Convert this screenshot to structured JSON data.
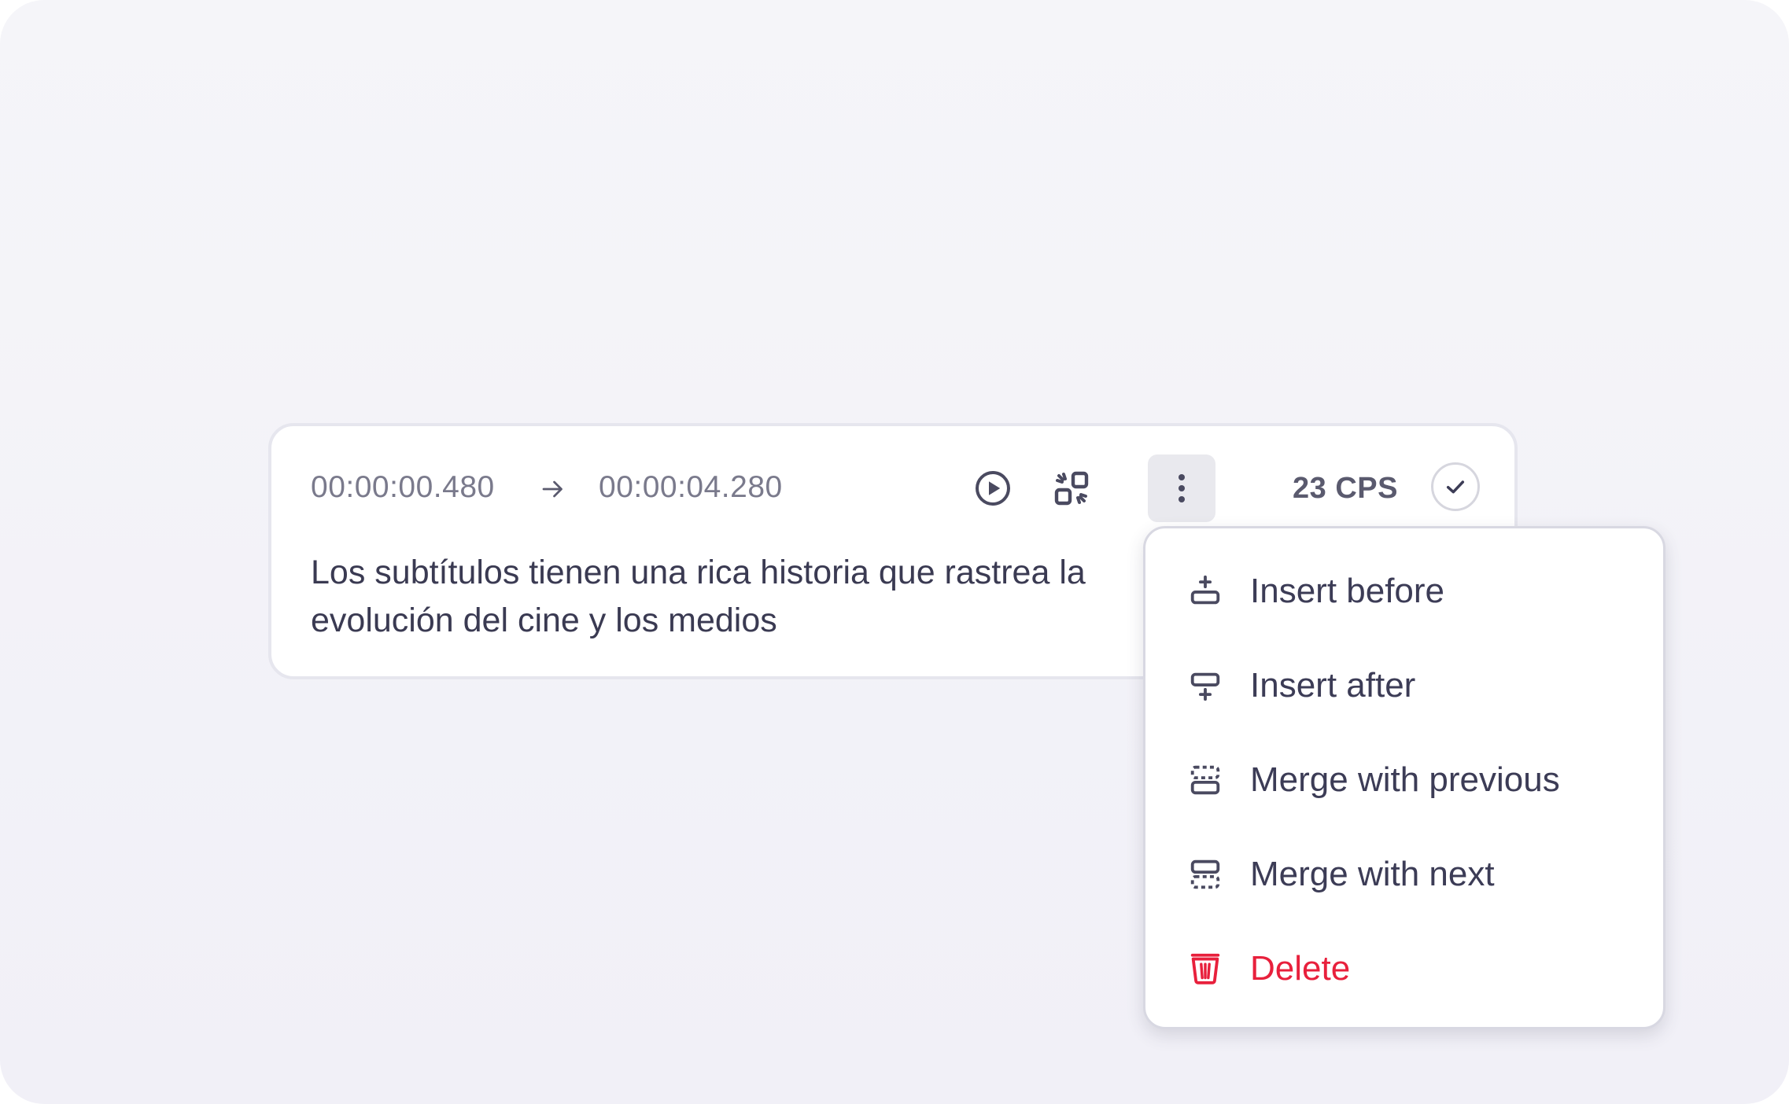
{
  "segment": {
    "start_time": "00:00:00.480",
    "end_time": "00:00:04.280",
    "cps": "23 CPS",
    "text": "Los subtítulos tienen una rica historia que rastrea la evolución del cine y los medios",
    "icons": {
      "arrow": "arrow-right-icon",
      "play": "play-circle-icon",
      "split": "split-icon",
      "more": "more-vertical-icon",
      "check": "check-icon"
    }
  },
  "menu": {
    "items": [
      {
        "label": "Insert before",
        "icon": "insert-before-icon"
      },
      {
        "label": "Insert after",
        "icon": "insert-after-icon"
      },
      {
        "label": "Merge with previous",
        "icon": "merge-previous-icon"
      },
      {
        "label": "Merge with next",
        "icon": "merge-next-icon"
      },
      {
        "label": "Delete",
        "icon": "trash-icon"
      }
    ]
  },
  "colors": {
    "text": "#3a3a52",
    "muted": "#7a7a8c",
    "icon": "#4a4a60",
    "danger": "#e8203c",
    "card_border": "#e6e6ee",
    "background": "#f3f3f8"
  }
}
